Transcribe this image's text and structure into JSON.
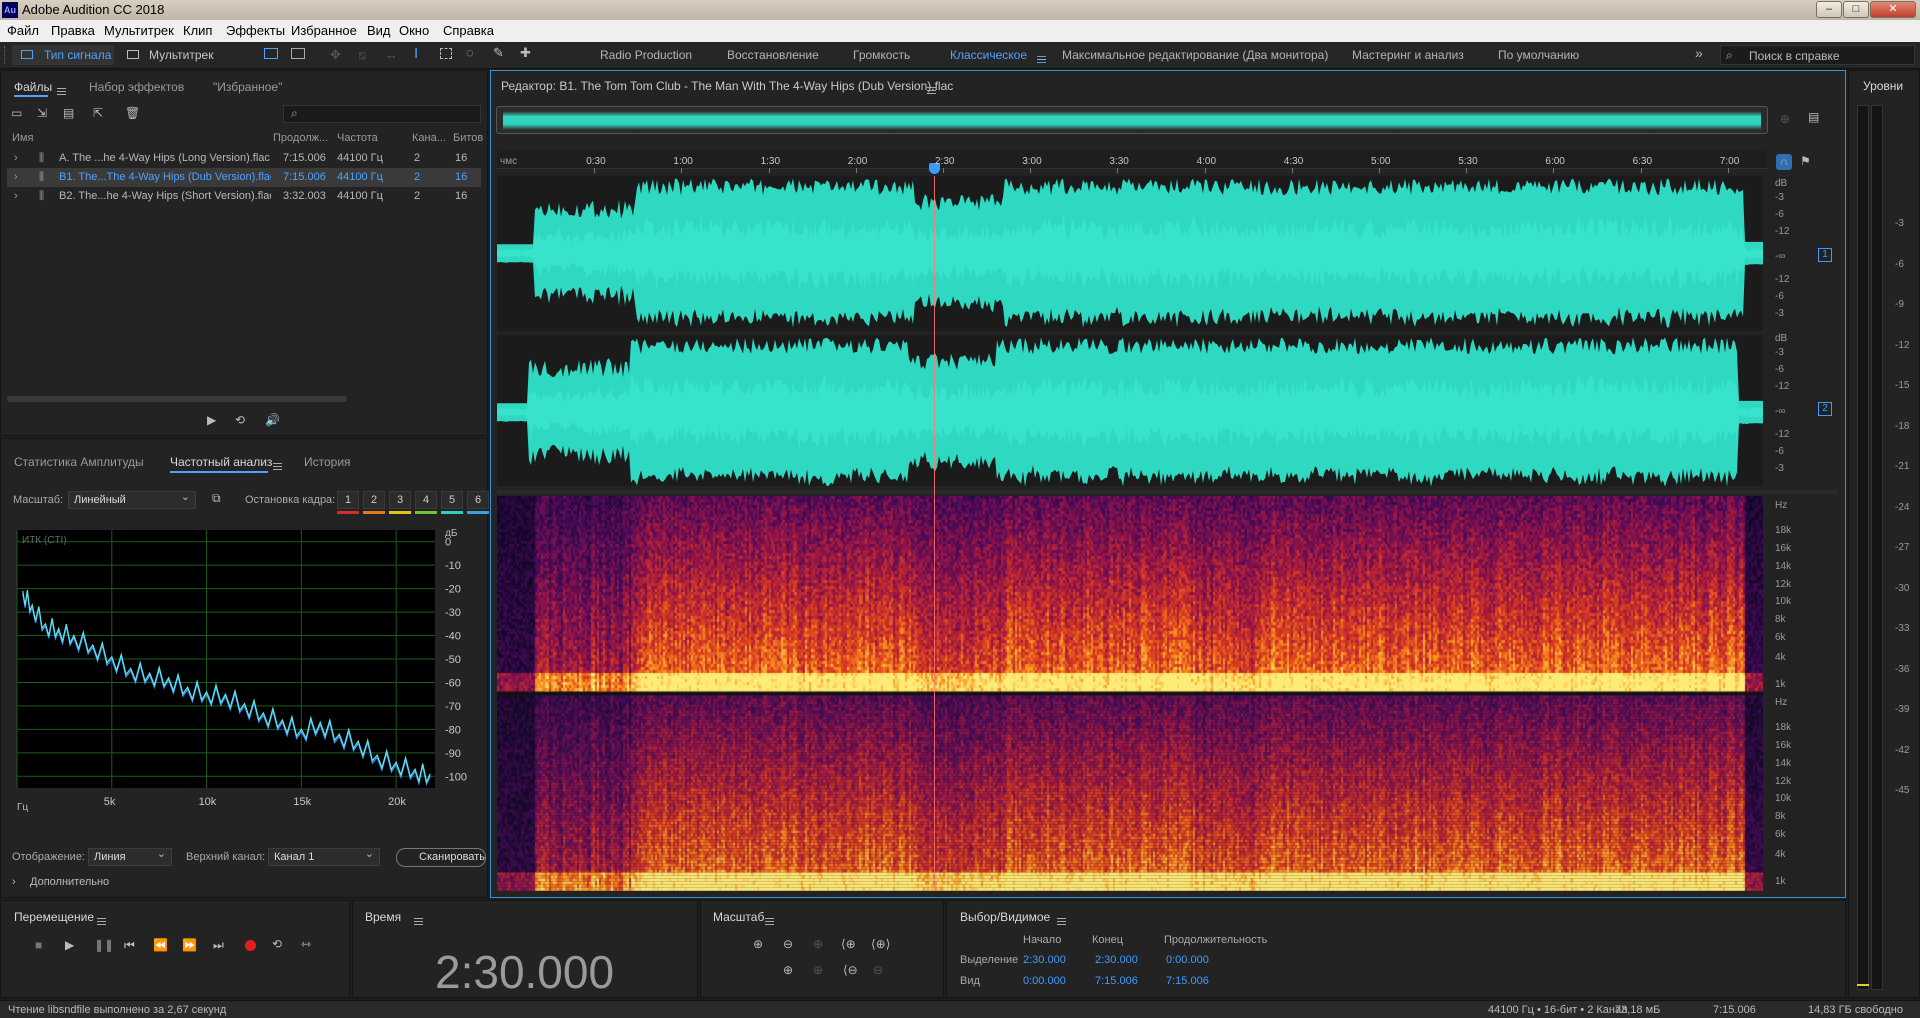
{
  "window": {
    "title": "Adobe Audition CC 2018",
    "logo": "Au",
    "controls": [
      "–",
      "□",
      "✕"
    ]
  },
  "menu": [
    "Файл",
    "Правка",
    "Мультитрек",
    "Клип",
    "Эффекты",
    "Избранное",
    "Вид",
    "Окно",
    "Справка"
  ],
  "toolbar": {
    "waveform_view": "Тип сигнала",
    "multitrack_view": "Мультитрек",
    "workspaces": [
      "Radio Production",
      "Восстановление",
      "Громкость",
      "Классическое",
      "Максимальное редактирование (Два монитора)",
      "Мастеринг и анализ",
      "По умолчанию"
    ],
    "active_workspace": "Классическое",
    "overflow": "»",
    "search_placeholder": "Поиск в справке"
  },
  "files_panel": {
    "tabs": [
      "Файлы",
      "Набор эффектов",
      "\"Избранное\""
    ],
    "search_icon": "⌕",
    "columns": [
      "Имя",
      "Продолж...",
      "Частота",
      "Кана...",
      "Битов"
    ],
    "files": [
      {
        "name": "A. The ...he 4-Way Hips (Long Version).flac",
        "duration": "7:15.006",
        "rate": "44100 Гц",
        "channels": "2",
        "bits": "16"
      },
      {
        "name": "B1. The...The 4-Way Hips (Dub Version).flac",
        "duration": "7:15.006",
        "rate": "44100 Гц",
        "channels": "2",
        "bits": "16"
      },
      {
        "name": "B2. The...he 4-Way Hips (Short Version).flac",
        "duration": "3:32.003",
        "rate": "44100 Гц",
        "channels": "2",
        "bits": "16"
      }
    ],
    "selected_index": 1
  },
  "analysis_panel": {
    "tabs": [
      "Статистика Амплитуды",
      "Частотный анализ",
      "История"
    ],
    "scale_label": "Масштаб:",
    "scale_value": "Линейный",
    "freeze_label": "Остановка кадра:",
    "freeze_slots": [
      "1",
      "2",
      "3",
      "4",
      "5",
      "6"
    ],
    "freeze_colors": [
      "#d62d2d",
      "#e07a1a",
      "#e0c21a",
      "#6dc43a",
      "#2dd0c0",
      "#3aa0e0"
    ],
    "display_label": "Отображение:",
    "display_value": "Линия",
    "channel_label": "Верхний канал:",
    "channel_value": "Канал 1",
    "scan_button": "Сканировать",
    "more_label": "Дополнительно"
  },
  "chart_data": {
    "type": "line",
    "title": "ИТК (CTI)",
    "xlabel": "Гц",
    "ylabel": "дБ",
    "x_ticks": [
      "Гц",
      "5k",
      "10k",
      "15k",
      "20k"
    ],
    "y_ticks": [
      "дБ",
      "0",
      "-10",
      "-20",
      "-30",
      "-40",
      "-50",
      "-60",
      "-70",
      "-80",
      "-90",
      "-100"
    ],
    "xlim": [
      0,
      22050
    ],
    "ylim": [
      -105,
      5
    ],
    "grid": true,
    "series": [
      {
        "color": "#3c8fff",
        "x": [
          300,
          800,
          1500,
          2200,
          3000,
          4000,
          5000,
          6000,
          7000,
          8000,
          9000,
          10000,
          11000,
          12000,
          13000,
          14000,
          15000,
          16000,
          17000,
          18000,
          19000,
          20000,
          21000,
          21800
        ],
        "values": [
          -22,
          -28,
          -36,
          -38,
          -41,
          -45,
          -50,
          -55,
          -57,
          -59,
          -63,
          -65,
          -66,
          -70,
          -74,
          -77,
          -81,
          -78,
          -83,
          -86,
          -92,
          -95,
          -98,
          -100
        ]
      },
      {
        "color": "#5de8e8",
        "x": [
          300,
          800,
          1500,
          2200,
          3000,
          4000,
          5000,
          6000,
          7000,
          8000,
          9000,
          10000,
          11000,
          12000,
          13000,
          14000,
          15000,
          16000,
          17000,
          18000,
          19000,
          20000,
          21000,
          21800
        ],
        "values": [
          -21,
          -27,
          -35,
          -37,
          -40,
          -44,
          -49,
          -54,
          -56,
          -58,
          -62,
          -64,
          -65,
          -69,
          -73,
          -76,
          -80,
          -77,
          -82,
          -85,
          -91,
          -94,
          -97,
          -99
        ]
      }
    ]
  },
  "editor": {
    "title": "Редактор: B1. The Tom Tom Club - The Man With The 4-Way Hips (Dub Version).flac",
    "time_unit": "чмс",
    "time_ticks": [
      "0:30",
      "1:00",
      "1:30",
      "2:00",
      "2:30",
      "3:00",
      "3:30",
      "4:00",
      "4:30",
      "5:00",
      "5:30",
      "6:00",
      "6:30",
      "7:00"
    ],
    "db_label": "dB",
    "db_ticks": [
      "-3",
      "-6",
      "-12",
      "-∞",
      "-12",
      "-6",
      "-3"
    ],
    "hz_label": "Hz",
    "hz_ticks": [
      "18k",
      "16k",
      "14k",
      "12k",
      "10k",
      "8k",
      "6k",
      "4k",
      "1k"
    ],
    "channel_badges": [
      "1",
      "2"
    ]
  },
  "levels": {
    "title": "Уровни",
    "ticks": [
      "-3",
      "-6",
      "-9",
      "-12",
      "-15",
      "-18",
      "-21",
      "-24",
      "-27",
      "-30",
      "-33",
      "-36",
      "-39",
      "-42",
      "-45"
    ]
  },
  "transport": {
    "title": "Перемещение",
    "buttons": [
      "stop",
      "play",
      "pause",
      "go-start",
      "rewind",
      "fast-forward",
      "go-end",
      "record",
      "loop",
      "skip"
    ]
  },
  "time_panel": {
    "title": "Время",
    "value": "2:30.000"
  },
  "zoom_panel": {
    "title": "Масштаб"
  },
  "selection_panel": {
    "title": "Выбор/Видимое",
    "headers": [
      "Начало",
      "Конец",
      "Продолжительность"
    ],
    "rows": [
      {
        "label": "Выделение",
        "start": "2:30.000",
        "end": "2:30.000",
        "duration": "0:00.000"
      },
      {
        "label": "Вид",
        "start": "0:00.000",
        "end": "7:15.006",
        "duration": "7:15.006"
      }
    ]
  },
  "status": {
    "message": "Чтение libsndfile выполнено за 2,67 секунд",
    "format": "44100 Гц • 16-бит • 2 Канал",
    "size": "73,18 мБ",
    "duration": "7:15.006",
    "free": "14,83 ГБ свободно"
  }
}
